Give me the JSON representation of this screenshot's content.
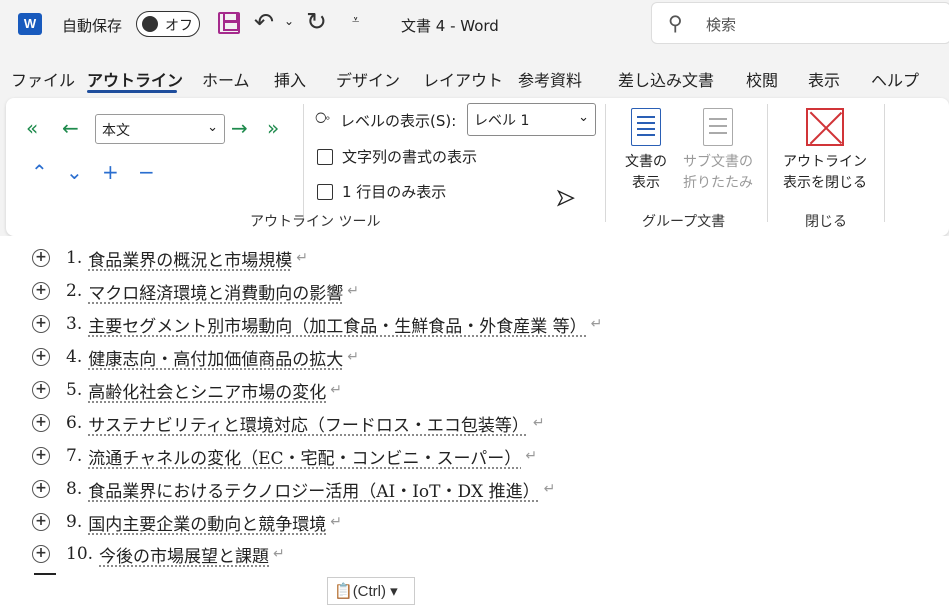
{
  "titlebar": {
    "app_icon": "word-icon",
    "autosave_label": "自動保存",
    "autosave_state": "オフ",
    "doc_title": "文書 4  -  Word",
    "search_placeholder": "検索"
  },
  "tabs": [
    {
      "label": "ファイル"
    },
    {
      "label": "アウトライン",
      "active": true
    },
    {
      "label": "ホーム"
    },
    {
      "label": "挿入"
    },
    {
      "label": "デザイン"
    },
    {
      "label": "レイアウト"
    },
    {
      "label": "参考資料"
    },
    {
      "label": "差し込み文書"
    },
    {
      "label": "校閲"
    },
    {
      "label": "表示"
    },
    {
      "label": "ヘルプ"
    }
  ],
  "ribbon": {
    "outline_tools": {
      "level_value": "本文",
      "show_level_label": "レベルの表示(S):",
      "show_level_value": "レベル 1",
      "show_text_formatting": "文字列の書式の表示",
      "show_first_line_only": "1 行目のみ表示",
      "group_label": "アウトライン ツール"
    },
    "master_document": {
      "show_document_line1": "文書の",
      "show_document_line2": "表示",
      "collapse_subdocs_line1": "サブ文書の",
      "collapse_subdocs_line2": "折りたたみ",
      "group_label": "グループ文書"
    },
    "close": {
      "close_outline_line1": "アウトライン",
      "close_outline_line2": "表示を閉じる",
      "group_label": "閉じる"
    }
  },
  "outline": [
    {
      "num": "1.",
      "text": "食品業界の概況と市場規模"
    },
    {
      "num": "2.",
      "text": "マクロ経済環境と消費動向の影響"
    },
    {
      "num": "3.",
      "text": "主要セグメント別市場動向（加工食品・生鮮食品・外食産業 等）"
    },
    {
      "num": "4.",
      "text": "健康志向・高付加価値商品の拡大"
    },
    {
      "num": "5.",
      "text": "高齢化社会とシニア市場の変化"
    },
    {
      "num": "6.",
      "text": "サステナビリティと環境対応（フードロス・エコ包装等）"
    },
    {
      "num": "7.",
      "text": "流通チャネルの変化（EC・宅配・コンビニ・スーパー）"
    },
    {
      "num": "8.",
      "text": "食品業界におけるテクノロジー活用（AI・IoT・DX 推進）"
    },
    {
      "num": "9.",
      "text": "国内主要企業の動向と競争環境"
    },
    {
      "num": "10.",
      "text": "今後の市場展望と課題"
    }
  ],
  "paste_options_label": "(Ctrl)"
}
